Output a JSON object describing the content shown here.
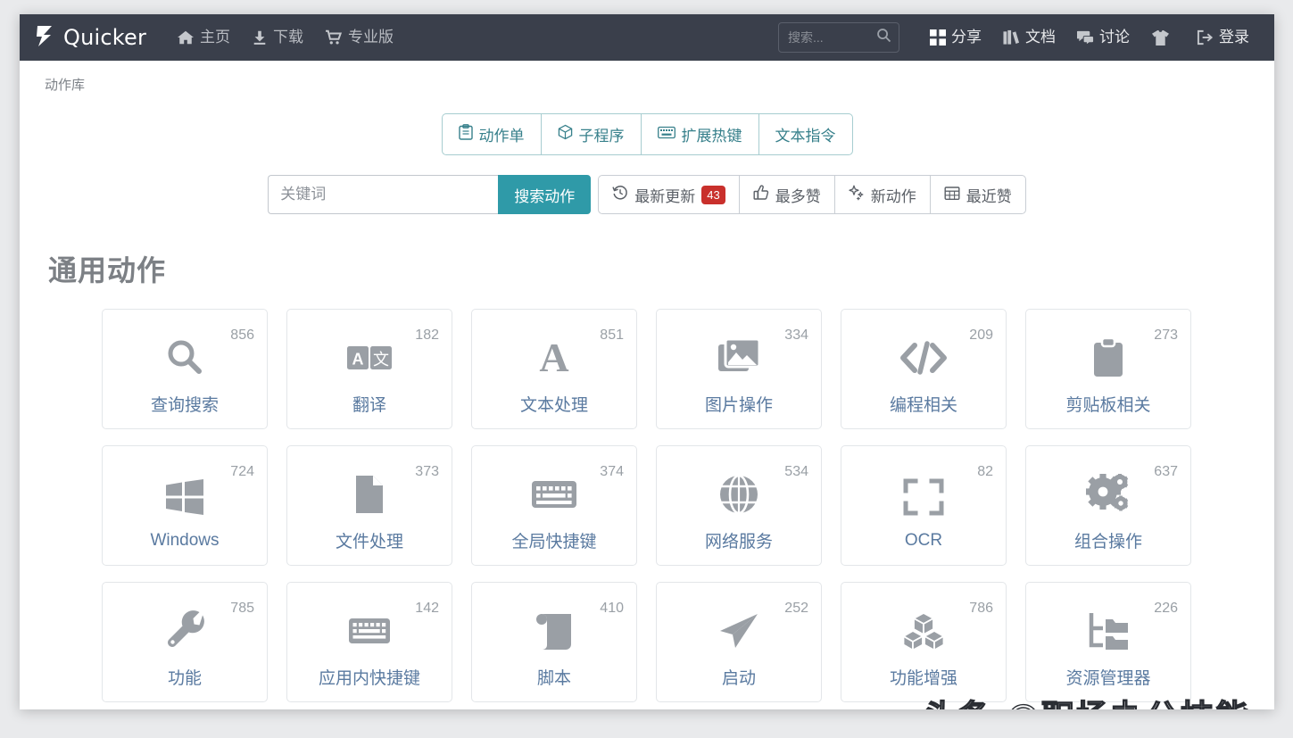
{
  "colors": {
    "navbar_bg": "#3a3f4b",
    "accent_teal": "#2f9aa8",
    "tab_border": "#a7cdd0",
    "badge_red": "#c9302c",
    "card_label": "#5a7aa0",
    "icon_gray": "#9a9fa5",
    "page_bg": "#e9eaec"
  },
  "navbar": {
    "logo_icon": "lightning-bolt-icon",
    "brand": "Quicker",
    "left_links": [
      {
        "label": "主页",
        "icon": "home-icon"
      },
      {
        "label": "下载",
        "icon": "download-icon"
      },
      {
        "label": "专业版",
        "icon": "shopping-cart-icon"
      }
    ],
    "search": {
      "placeholder": "搜索...",
      "value": "",
      "icon": "search-icon"
    },
    "right_links": [
      {
        "label": "分享",
        "icon": "grid-squares-icon"
      },
      {
        "label": "文档",
        "icon": "books-icon"
      },
      {
        "label": "讨论",
        "icon": "comments-icon"
      },
      {
        "label": "",
        "icon": "t-shirt-icon"
      },
      {
        "label": "登录",
        "icon": "sign-in-icon"
      }
    ]
  },
  "breadcrumb": {
    "label": "动作库"
  },
  "tabs": [
    {
      "label": "动作单",
      "icon": "clipboard-icon"
    },
    {
      "label": "子程序",
      "icon": "cube-icon"
    },
    {
      "label": "扩展热键",
      "icon": "keyboard-icon"
    },
    {
      "label": "文本指令",
      "icon": ""
    }
  ],
  "search_action": {
    "keyword_placeholder": "关键词",
    "keyword_value": "",
    "button_label": "搜索动作"
  },
  "filters": [
    {
      "label": "最新更新",
      "icon": "history-clock-icon",
      "badge": "43"
    },
    {
      "label": "最多赞",
      "icon": "thumbs-up-icon",
      "badge": ""
    },
    {
      "label": "新动作",
      "icon": "sparkle-icon",
      "badge": ""
    },
    {
      "label": "最近赞",
      "icon": "calendar-icon",
      "badge": ""
    }
  ],
  "section": {
    "title": "通用动作",
    "cards": [
      {
        "label": "查询搜索",
        "count": "856",
        "icon": "magnifier-icon"
      },
      {
        "label": "翻译",
        "count": "182",
        "icon": "translate-icon"
      },
      {
        "label": "文本处理",
        "count": "851",
        "icon": "letter-a-icon"
      },
      {
        "label": "图片操作",
        "count": "334",
        "icon": "images-icon"
      },
      {
        "label": "编程相关",
        "count": "209",
        "icon": "code-brackets-icon"
      },
      {
        "label": "剪贴板相关",
        "count": "273",
        "icon": "clipboard-icon"
      },
      {
        "label": "Windows",
        "count": "724",
        "icon": "windows-logo-icon"
      },
      {
        "label": "文件处理",
        "count": "373",
        "icon": "file-icon"
      },
      {
        "label": "全局快捷键",
        "count": "374",
        "icon": "keyboard-icon"
      },
      {
        "label": "网络服务",
        "count": "534",
        "icon": "globe-icon"
      },
      {
        "label": "OCR",
        "count": "82",
        "icon": "crop-frame-icon"
      },
      {
        "label": "组合操作",
        "count": "637",
        "icon": "gears-icon"
      },
      {
        "label": "功能",
        "count": "785",
        "icon": "wrench-icon"
      },
      {
        "label": "应用内快捷键",
        "count": "142",
        "icon": "keyboard-icon"
      },
      {
        "label": "脚本",
        "count": "410",
        "icon": "scroll-icon"
      },
      {
        "label": "启动",
        "count": "252",
        "icon": "paper-plane-icon"
      },
      {
        "label": "功能增强",
        "count": "786",
        "icon": "boxes-icon"
      },
      {
        "label": "资源管理器",
        "count": "226",
        "icon": "folder-tree-icon"
      }
    ]
  },
  "watermark": {
    "text": "头条 @职场办公技能"
  }
}
